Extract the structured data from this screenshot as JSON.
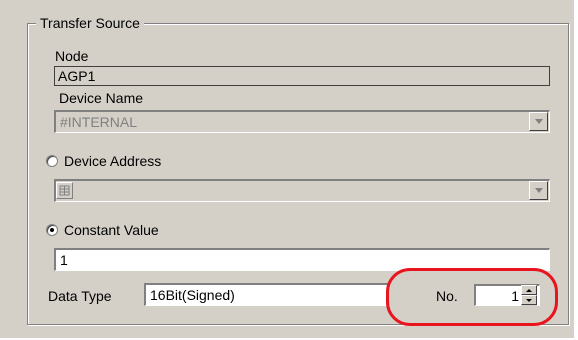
{
  "group": {
    "title": "Transfer Source"
  },
  "node": {
    "label": "Node",
    "value": "AGP1"
  },
  "device_name": {
    "label": "Device Name",
    "value": "#INTERNAL"
  },
  "device_address": {
    "label": "Device Address",
    "selected": false,
    "value": ""
  },
  "constant_value": {
    "label": "Constant Value",
    "selected": true,
    "value": "1"
  },
  "data_type": {
    "label": "Data Type",
    "value": "16Bit(Signed)"
  },
  "number": {
    "label": "No.",
    "value": "1"
  },
  "colors": {
    "highlight": "#e8141e",
    "panel": "#d4d0c8"
  },
  "icons": {
    "address_picker": "grid-icon"
  }
}
